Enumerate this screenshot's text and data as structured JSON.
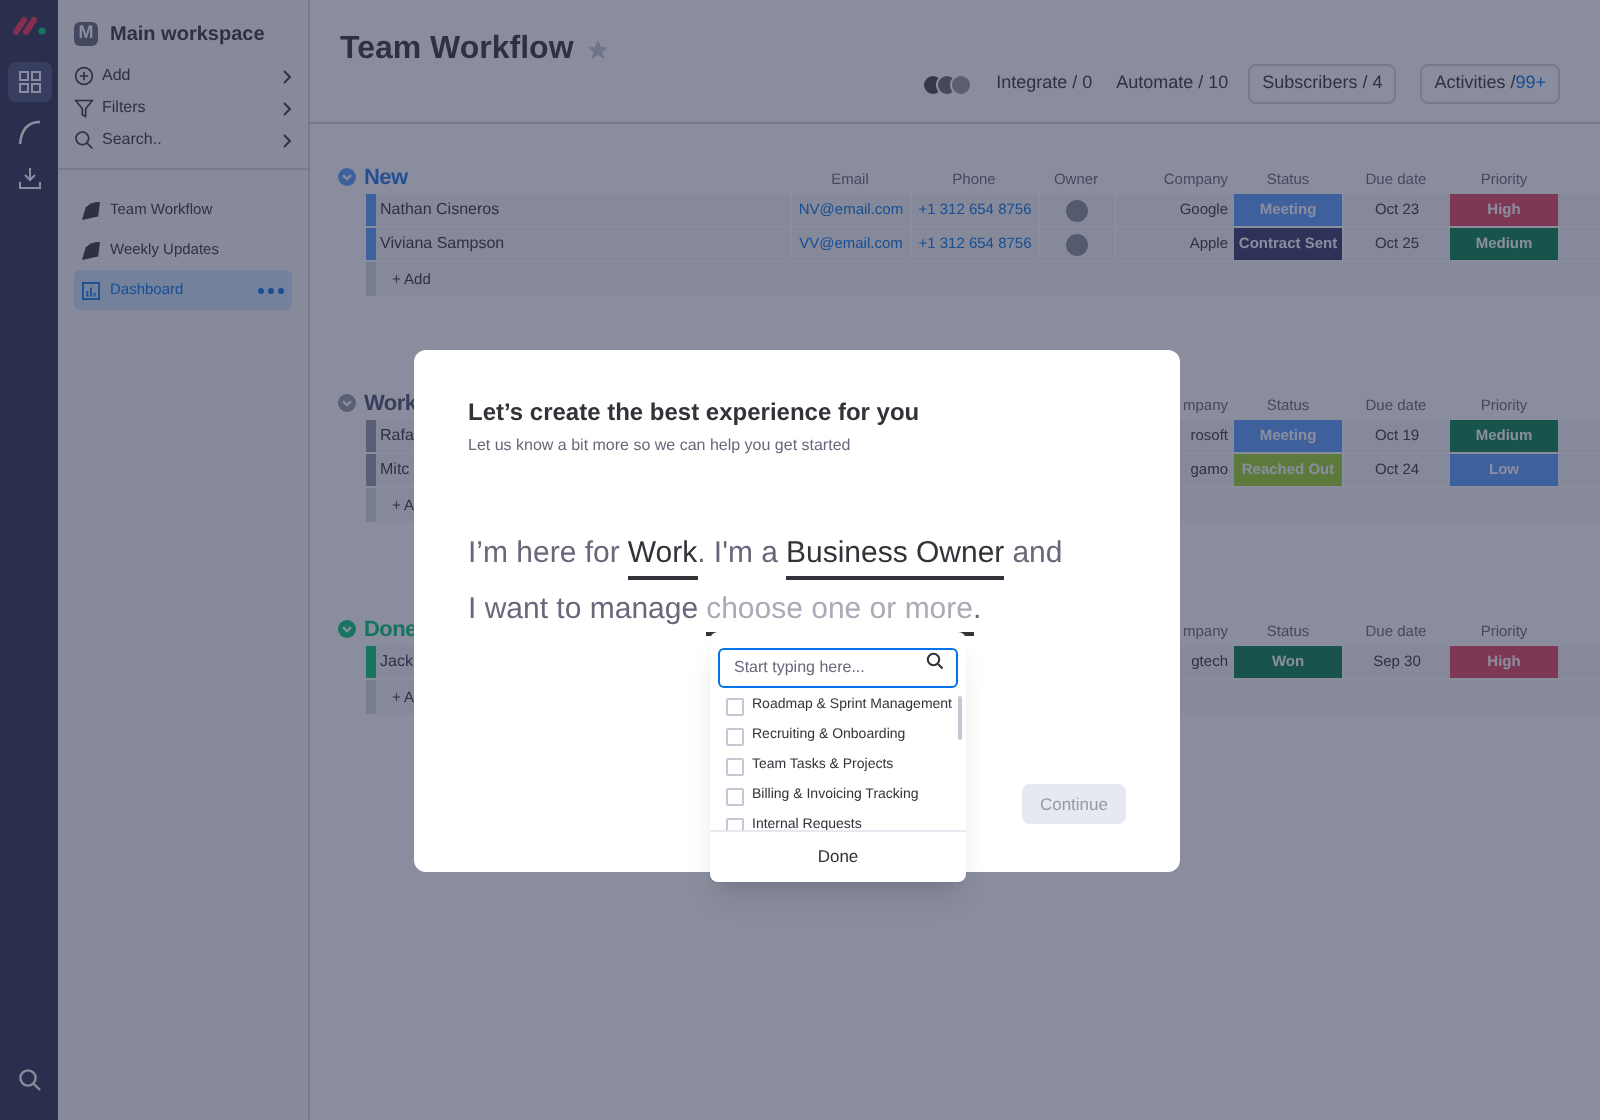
{
  "workspace": {
    "initial": "M",
    "name": "Main workspace"
  },
  "sidebar_actions": [
    {
      "kind": "add",
      "label": "Add"
    },
    {
      "kind": "filter",
      "label": "Filters"
    },
    {
      "kind": "search",
      "label": "Search.."
    }
  ],
  "boards": [
    {
      "kind": "board",
      "label": "Team Workflow",
      "selected": false
    },
    {
      "kind": "board",
      "label": "Weekly Updates",
      "selected": false
    },
    {
      "kind": "dashboard",
      "label": "Dashboard",
      "selected": true
    }
  ],
  "board": {
    "title": "Team Workflow",
    "starred": false,
    "integrate": "Integrate / 0",
    "automate": "Automate / 10",
    "subscribers": "Subscribers / 4",
    "activities": "Activities /",
    "activities_count": "99+"
  },
  "groups": [
    {
      "title": "New",
      "kind": "new",
      "headers": {
        "email": "Email",
        "phone": "Phone",
        "owner": "Owner",
        "company": "Company",
        "status": "Status",
        "due": "Due date",
        "priority": "Priority"
      },
      "rows": [
        {
          "name": "Nathan Cisneros",
          "email": "NV@email.com",
          "phone": "+1 312 654 8756",
          "owner_avatar": true,
          "company": "Google",
          "status": {
            "text": "Meeting",
            "kind": "meeting"
          },
          "due": "Oct 23",
          "priority": {
            "text": "High",
            "kind": "high"
          }
        },
        {
          "name": "Viviana Sampson",
          "email": "VV@email.com",
          "phone": "+1 312 654 8756",
          "owner_avatar": true,
          "company": "Apple",
          "status": {
            "text": "Contract Sent",
            "kind": "contract"
          },
          "due": "Oct 25",
          "priority": {
            "text": "Medium",
            "kind": "medium"
          }
        }
      ],
      "add": "+ Add"
    },
    {
      "title": "Work",
      "kind": "working",
      "headers": {
        "company": "mpany",
        "status": "Status",
        "due": "Due date",
        "priority": "Priority"
      },
      "rows": [
        {
          "name": "Rafa",
          "company": "rosoft",
          "status": {
            "text": "Meeting",
            "kind": "meeting"
          },
          "due": "Oct 19",
          "priority": {
            "text": "Medium",
            "kind": "medium"
          }
        },
        {
          "name": "Mitc",
          "company": "gamo",
          "status": {
            "text": "Reached Out",
            "kind": "reached"
          },
          "due": "Oct 24",
          "priority": {
            "text": "Low",
            "kind": "low"
          }
        }
      ],
      "add": "+ A"
    },
    {
      "title": "Done",
      "kind": "done",
      "headers": {
        "company": "mpany",
        "status": "Status",
        "due": "Due date",
        "priority": "Priority"
      },
      "rows": [
        {
          "name": "Jack",
          "company": "gtech",
          "status": {
            "text": "Won",
            "kind": "won"
          },
          "due": "Sep 30",
          "priority": {
            "text": "High",
            "kind": "high"
          }
        }
      ],
      "add": "+ A"
    }
  ],
  "modal": {
    "title": "Let’s create the best experience for you",
    "subtitle": "Let us know a bit more so we can help you get started",
    "sentence": [
      [
        {
          "kind": "text",
          "text": "I’m here for"
        },
        {
          "kind": "choice",
          "text": "Work"
        },
        {
          "kind": "text",
          "text": ". I'm a"
        },
        {
          "kind": "choice",
          "text": "Business Owner"
        },
        {
          "kind": "text",
          "text": "and"
        }
      ],
      [
        {
          "kind": "text",
          "text": "I want to manage"
        },
        {
          "kind": "placeholder",
          "text": "choose one or more"
        },
        {
          "kind": "text",
          "text": "."
        }
      ]
    ],
    "dropdown": {
      "placeholder": "Start typing here...",
      "options": [
        {
          "label": "Roadmap & Sprint Management",
          "checked": false
        },
        {
          "label": "Recruiting & Onboarding",
          "checked": false
        },
        {
          "label": "Team Tasks & Projects",
          "checked": false
        },
        {
          "label": "Billing & Invoicing Tracking",
          "checked": false
        },
        {
          "label": "Internal Requests",
          "checked": false
        }
      ],
      "done": "Done"
    },
    "continue": {
      "label": "Continue",
      "disabled": true
    }
  }
}
